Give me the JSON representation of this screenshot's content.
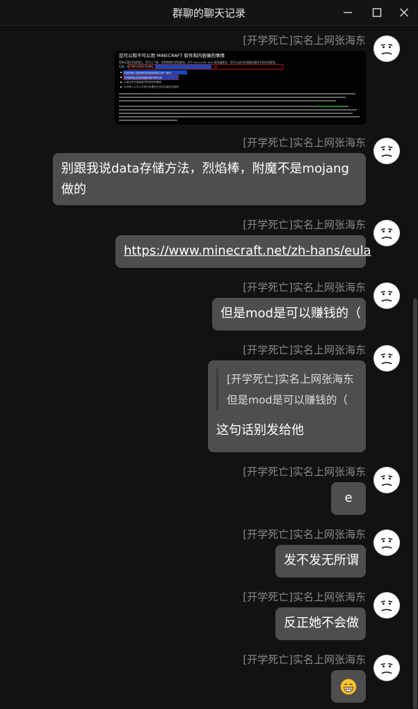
{
  "window": {
    "title": "群聊的聊天记录",
    "controls": [
      "minimize-icon",
      "maximize-icon",
      "close-icon"
    ]
  },
  "messages": [
    {
      "sender": "[开学死亡]实名上网张海东",
      "type": "image",
      "image": {
        "heading": "您可以和不可以用 MINECRAFT 软件和内容做的事情",
        "lines": [
          "您购买我们的游戏后，您可以下载、安装和操作游戏副本。对于 Minecraft: Java 服务器版本，您可以自行安装服务器并主持在线游戏。",
          "但是，您不得分发我们的游戏，也不得分发任何修改版本或者任何内容。",
          "向任何他人提供我们的游戏或其中的一部分",
          "任何修改过的游戏副本都不得分发",
          "以商业形式使用我们的游戏来赚钱",
          "允许他人以不公平或不合理的方式访问我们的游戏"
        ]
      }
    },
    {
      "sender": "[开学死亡]实名上网张海东",
      "type": "text",
      "text": "别跟我说data存储方法，烈焰棒，附魔不是mojang做的"
    },
    {
      "sender": "[开学死亡]实名上网张海东",
      "type": "link",
      "text": "https://www.minecraft.net/zh-hans/eula"
    },
    {
      "sender": "[开学死亡]实名上网张海东",
      "type": "text",
      "text": "但是mod是可以赚钱的（"
    },
    {
      "sender": "[开学死亡]实名上网张海东",
      "type": "reply",
      "quote_sender": "[开学死亡]实名上网张海东",
      "quote_text": "但是mod是可以赚钱的（",
      "text": "这句话别发给他"
    },
    {
      "sender": "[开学死亡]实名上网张海东",
      "type": "text",
      "text": "e"
    },
    {
      "sender": "[开学死亡]实名上网张海东",
      "type": "text",
      "text": "发不发无所谓"
    },
    {
      "sender": "[开学死亡]实名上网张海东",
      "type": "text",
      "text": "反正她不会做"
    },
    {
      "sender": "[开学死亡]实名上网张海东",
      "type": "emoji",
      "text": "😁"
    }
  ],
  "avatar_icon": "annoyed-face-icon",
  "colors": {
    "background": "#121212",
    "bubble": "#4e4e4e",
    "sender_text": "#8a8a8a",
    "message_text": "#ffffff"
  }
}
